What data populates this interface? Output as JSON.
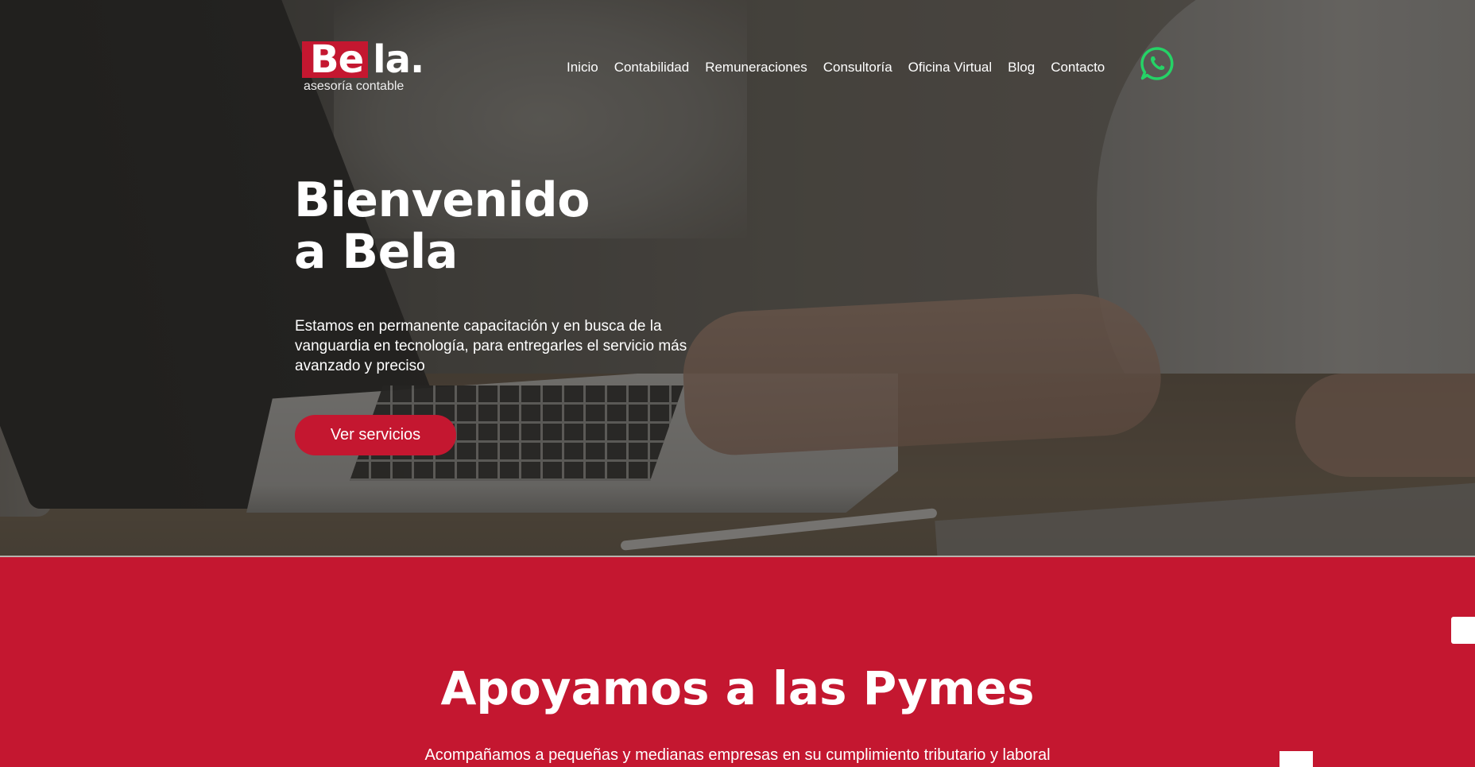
{
  "brand": {
    "logo_be": "Be",
    "logo_la": "la.",
    "tagline": "asesoría contable",
    "accent": "#c41730"
  },
  "nav": {
    "items": [
      {
        "label": "Inicio"
      },
      {
        "label": "Contabilidad"
      },
      {
        "label": "Remuneraciones"
      },
      {
        "label": "Consultoría"
      },
      {
        "label": "Oficina Virtual"
      },
      {
        "label": "Blog"
      },
      {
        "label": "Contacto"
      }
    ],
    "whatsapp_icon": "whatsapp-icon",
    "whatsapp_color": "#25d366"
  },
  "hero": {
    "title_line1": "Bienvenido",
    "title_line2": "a Bela",
    "description": "Estamos en permanente capacitación y en busca de la vanguardia en tecnología, para entregarles el servicio más avanzado y preciso",
    "cta_label": "Ver servicios"
  },
  "section": {
    "title": "Apoyamos a las Pymes",
    "text": "Acompañamos a pequeñas y medianas empresas en su cumplimiento tributario y laboral"
  }
}
